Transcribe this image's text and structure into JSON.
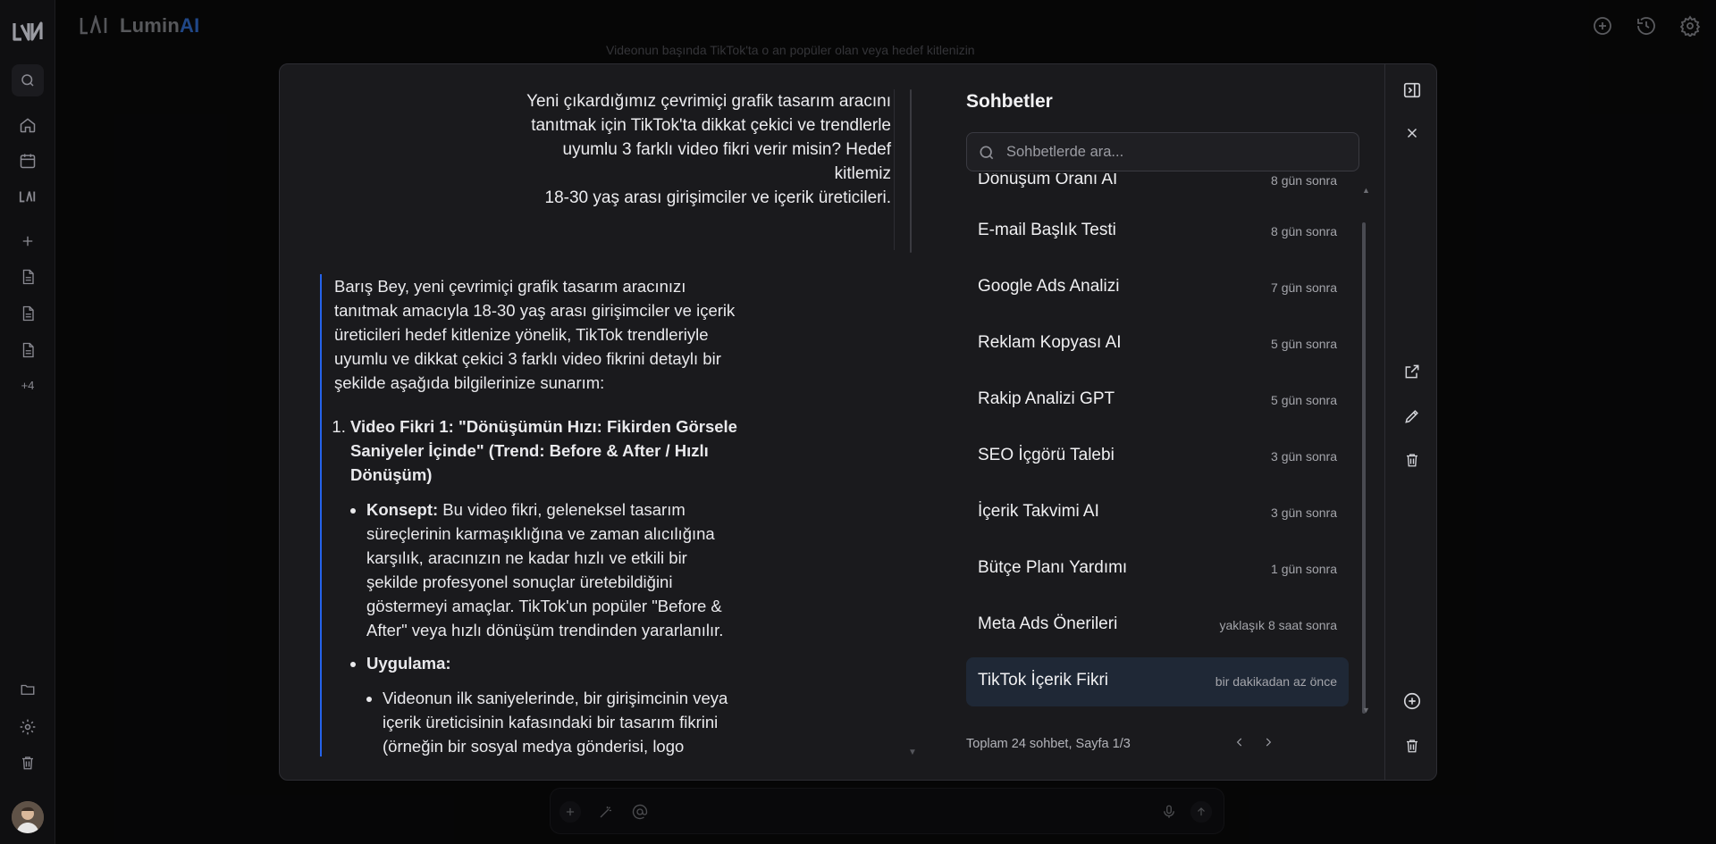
{
  "app": {
    "brand_prefix": "Lumin",
    "brand_suffix": "AI"
  },
  "rail": {
    "more_label": "+4"
  },
  "background": {
    "partial_text": "Videonun başında TikTok'ta o an popüler olan veya hedef kitlenizin"
  },
  "preview": {
    "user_message_lines": [
      "Yeni çıkardığımız çevrimiçi grafik tasarım aracını",
      "tanıtmak için TikTok'ta dikkat çekici ve trendlerle",
      "uyumlu 3 farklı video fikri verir misin? Hedef kitlemiz",
      "18-30 yaş arası girişimciler ve içerik üreticileri."
    ],
    "ai_intro": "Barış Bey, yeni çevrimiçi grafik tasarım aracınızı tanıtmak amacıyla 18-30 yaş arası girişimciler ve içerik üreticileri hedef kitlenize yönelik, TikTok trendleriyle uyumlu ve dikkat çekici 3 farklı video fikrini detaylı bir şekilde aşağıda bilgilerinize sunarım:",
    "idea1_title": "Video Fikri 1: \"Dönüşümün Hızı: Fikirden Görsele Saniyeler İçinde\" (Trend: Before & After / Hızlı Dönüşüm)",
    "concept_label": "Konsept:",
    "concept_text": " Bu video fikri, geleneksel tasarım süreçlerinin karmaşıklığına ve zaman alıcılığına karşılık, aracınızın ne kadar hızlı ve etkili bir şekilde profesyonel sonuçlar üretebildiğini göstermeyi amaçlar. TikTok'un popüler \"Before & After\" veya hızlı dönüşüm trendinden yararlanılır.",
    "apply_label": "Uygulama:",
    "apply_text": "Videonun ilk saniyelerinde, bir girişimcinin veya içerik üreticisinin kafasındaki bir tasarım fikrini (örneğin bir sosyal medya gönderisi, logo"
  },
  "sidebar": {
    "title": "Sohbetler",
    "search_placeholder": "Sohbetlerde ara...",
    "partial_item": {
      "title": "Dönüşüm Oranı AI",
      "date": "8 gün sonra"
    },
    "items": [
      {
        "title": "E-mail Başlık Testi",
        "date": "8 gün sonra"
      },
      {
        "title": "Google Ads Analizi",
        "date": "7 gün sonra"
      },
      {
        "title": "Reklam Kopyası AI",
        "date": "5 gün sonra"
      },
      {
        "title": "Rakip Analizi GPT",
        "date": "5 gün sonra"
      },
      {
        "title": "SEO İçgörü Talebi",
        "date": "3 gün sonra"
      },
      {
        "title": "İçerik Takvimi AI",
        "date": "3 gün sonra"
      },
      {
        "title": "Bütçe Planı Yardımı",
        "date": "1 gün sonra"
      },
      {
        "title": "Meta Ads Önerileri",
        "date": "yaklaşık 8 saat sonra"
      },
      {
        "title": "TikTok İçerik Fikri",
        "date": "bir dakikadan az önce"
      }
    ],
    "footer": "Toplam 24 sohbet, Sayfa 1/3"
  },
  "colors": {
    "accent": "#2563eb",
    "brand_ai": "#3b82f6",
    "active_item": "#1f2836"
  }
}
